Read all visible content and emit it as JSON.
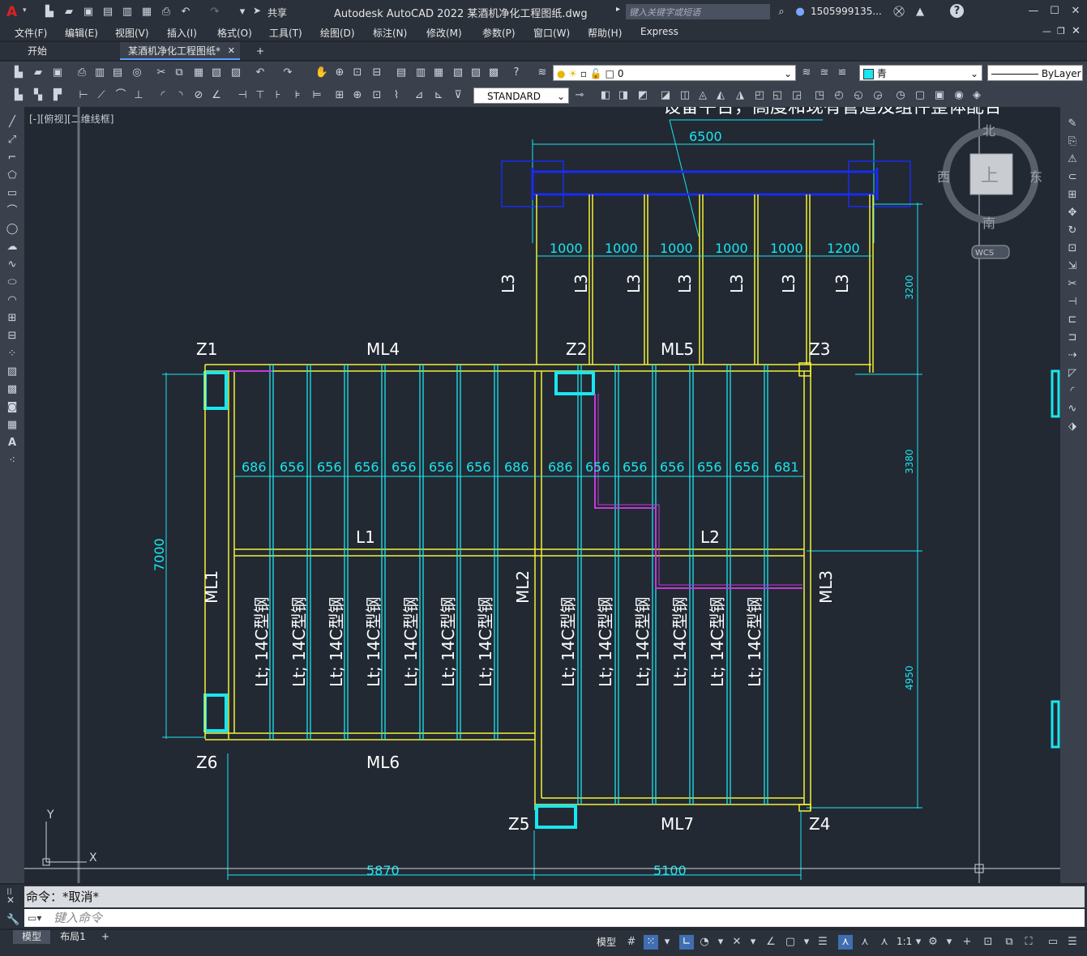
{
  "window": {
    "app_logo": "A",
    "title": "Autodesk AutoCAD 2022    某酒机净化工程图纸.dwg",
    "share_label": "共享",
    "search_placeholder": "键入关键字或短语",
    "user": "1505999135...",
    "help": "?"
  },
  "menu": [
    "文件(F)",
    "编辑(E)",
    "视图(V)",
    "插入(I)",
    "格式(O)",
    "工具(T)",
    "绘图(D)",
    "标注(N)",
    "修改(M)",
    "参数(P)",
    "窗口(W)",
    "帮助(H)",
    "Express"
  ],
  "tabs": {
    "start": "开始",
    "drawing": "某酒机净化工程图纸*",
    "add": "+"
  },
  "toolbar": {
    "layer_value": "0",
    "color_value": "青",
    "linetype_value": "ByLayer",
    "textstyle_value": "STANDARD"
  },
  "viewport_label": "[-][俯视][二维线框]",
  "viewcube": {
    "north": "北",
    "south": "南",
    "east": "东",
    "west": "西",
    "face": "上",
    "wcs": "WCS"
  },
  "drawing": {
    "top_note": "设备平台，高度和现有管道及组件整体配合",
    "dim_top_total": "6500",
    "dim_top_segments": [
      "1000",
      "1000",
      "1000",
      "1000",
      "1000",
      "1200"
    ],
    "L3_labels": [
      "L3",
      "L3",
      "L3",
      "L3",
      "L3",
      "L3",
      "L3"
    ],
    "right_dims": [
      "3200",
      "3380",
      "4950"
    ],
    "left_dim": "7000",
    "bottom_dims": [
      "5870",
      "5100"
    ],
    "columns": [
      "Z1",
      "Z2",
      "Z3",
      "Z4",
      "Z5",
      "Z6"
    ],
    "beams": {
      "ML4": "ML4",
      "ML5": "ML5",
      "ML6": "ML6",
      "ML7": "ML7",
      "ML1": "ML1",
      "ML2": "ML2",
      "ML3": "ML3",
      "L1": "L1",
      "L2": "L2"
    },
    "spacing_left": [
      "686",
      "656",
      "656",
      "656",
      "656",
      "656",
      "656",
      "686"
    ],
    "spacing_right": [
      "686",
      "656",
      "656",
      "656",
      "656",
      "656",
      "681"
    ],
    "joist_label": "Lt; 14C型钢",
    "ucs_y": "Y",
    "ucs_x": "X"
  },
  "command": {
    "history": "命令：*取消*",
    "input_placeholder": "键入命令"
  },
  "layout_tabs": [
    "模型",
    "布局1",
    "+"
  ],
  "status": {
    "model": "模型",
    "scale": "1:1"
  },
  "colors": {
    "yellow": "#f5f233",
    "cyan": "#19e6f0",
    "blue": "#1a2cf0",
    "magenta": "#c23bd6",
    "background": "#222933"
  }
}
